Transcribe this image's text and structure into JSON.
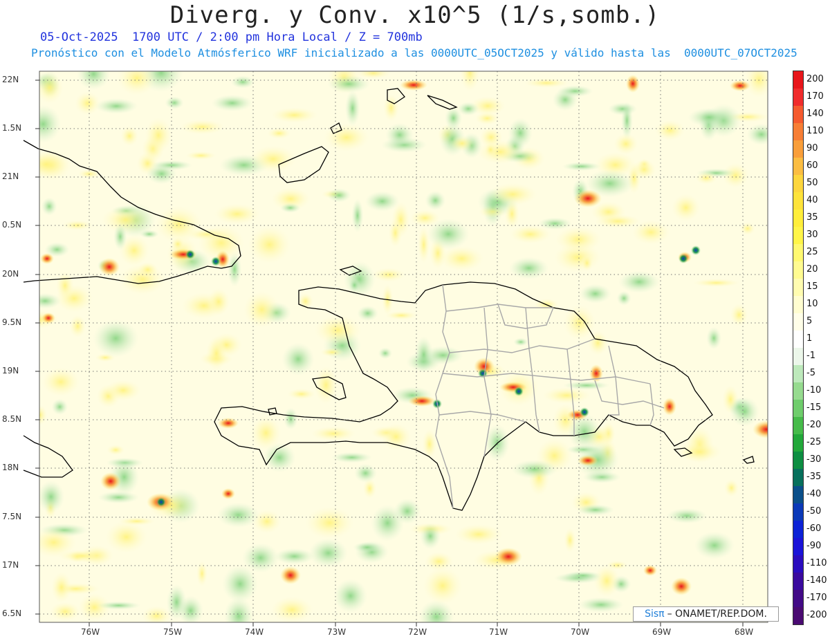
{
  "header": {
    "title": "Diverg. y Conv. x10^5 (1/s,somb.)",
    "line1": "05-Oct-2025  1700 UTC / 2:00 pm Hora Local / Z = 700mb",
    "line2": "Pronóstico con el Modelo Atmósferico WRF inicializado a las 0000UTC_05OCT2025 y válido hasta las  0000UTC_07OCT2025"
  },
  "map": {
    "lat_labels": [
      "22N",
      "1.5N",
      "21N",
      "0.5N",
      "20N",
      "9.5N",
      "19N",
      "8.5N",
      "18N",
      "7.5N",
      "17N",
      "6.5N"
    ],
    "lon_labels": [
      "76W",
      "75W",
      "74W",
      "73W",
      "72W",
      "71W",
      "70W",
      "69W",
      "68W"
    ],
    "lat_range": [
      16.5,
      22.0
    ],
    "lon_range": [
      -76.7,
      -67.6
    ]
  },
  "colorbar": {
    "labels": [
      "200",
      "170",
      "140",
      "110",
      "90",
      "60",
      "50",
      "40",
      "35",
      "30",
      "25",
      "20",
      "15",
      "10",
      "5",
      "1",
      "-1",
      "-5",
      "-10",
      "-15",
      "-20",
      "-25",
      "-30",
      "-35",
      "-40",
      "-50",
      "-60",
      "-90",
      "-110",
      "-140",
      "-170",
      "-200"
    ],
    "colors": [
      "#e8161b",
      "#f02c2c",
      "#f55a2e",
      "#f77e35",
      "#f99e3a",
      "#fbbd42",
      "#fdd63d",
      "#fee33a",
      "#ffee3a",
      "#fff548",
      "#fff970",
      "#fffb90",
      "#fffcb0",
      "#fffdd0",
      "#fffee8",
      "#ffffff",
      "#ecf7ea",
      "#bde9bb",
      "#96db8f",
      "#6fcd6c",
      "#46bb4a",
      "#22a83a",
      "#0d8e42",
      "#07705c",
      "#0a4f8a",
      "#0b39b8",
      "#0c22d6",
      "#1a13d8",
      "#2a0cbe",
      "#3a0a9e",
      "#420a86",
      "#4a0a72"
    ]
  },
  "credit": {
    "system": "Sisπ",
    "text": "– ONAMET/REP.DOM."
  }
}
